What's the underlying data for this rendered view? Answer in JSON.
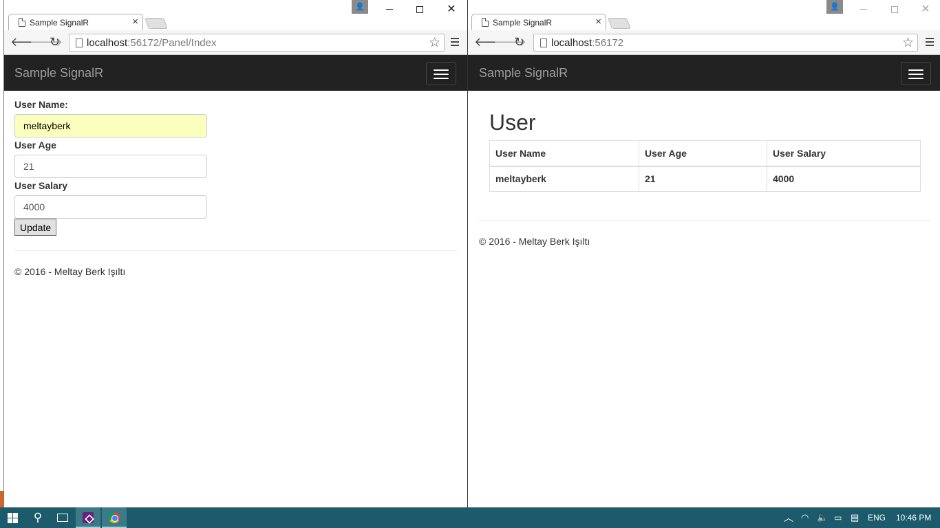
{
  "left_window": {
    "tab_title": "Sample SignalR",
    "url_host": "localhost",
    "url_rest": ":56172/Panel/Index",
    "brand": "Sample SignalR",
    "form": {
      "username_label": "User Name:",
      "username_value": "meltayberk",
      "age_label": "User Age",
      "age_value": "21",
      "salary_label": "User Salary",
      "salary_value": "4000",
      "update_label": "Update"
    },
    "footer": "© 2016 - Meltay Berk Işıltı"
  },
  "right_window": {
    "tab_title": "Sample SignalR",
    "url_host": "localhost",
    "url_rest": ":56172",
    "brand": "Sample SignalR",
    "heading": "User",
    "table": {
      "headers": [
        "User Name",
        "User Age",
        "User Salary"
      ],
      "rows": [
        [
          "meltayberk",
          "21",
          "4000"
        ]
      ]
    },
    "footer": "© 2016 - Meltay Berk Işıltı"
  },
  "taskbar": {
    "language": "ENG",
    "time": "10:46 PM"
  },
  "colors": {
    "navbar": "#222222",
    "brand_text": "#9d9d9d",
    "autofill": "#faffbd",
    "taskbar": "#1b5b6b"
  }
}
